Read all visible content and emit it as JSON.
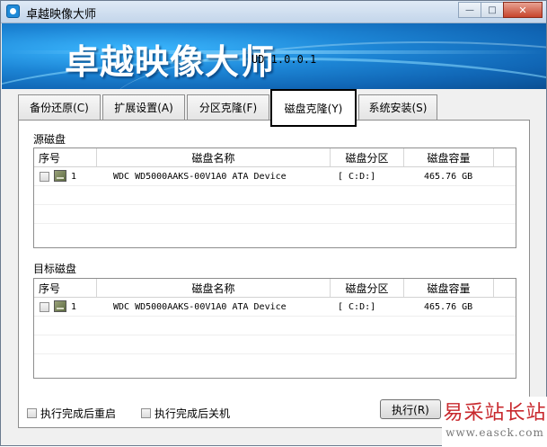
{
  "window": {
    "title": "卓越映像大师",
    "controls": {
      "minimize": "—",
      "maximize": "□",
      "close": "✕"
    }
  },
  "banner": {
    "title": "卓越映像大师",
    "version": "UD 1.0.0.1"
  },
  "tabs": [
    {
      "label": "备份还原(C)",
      "active": false
    },
    {
      "label": "扩展设置(A)",
      "active": false
    },
    {
      "label": "分区克隆(F)",
      "active": false
    },
    {
      "label": "磁盘克隆(Y)",
      "active": true
    },
    {
      "label": "系统安装(S)",
      "active": false
    }
  ],
  "source": {
    "label": "源磁盘",
    "columns": [
      "序号",
      "磁盘名称",
      "磁盘分区",
      "磁盘容量"
    ],
    "rows": [
      {
        "index": "1",
        "name": "WDC WD5000AAKS-00V1A0 ATA Device",
        "partition": "[ C:D:]",
        "capacity": "465.76 GB",
        "checked": false
      }
    ]
  },
  "target": {
    "label": "目标磁盘",
    "columns": [
      "序号",
      "磁盘名称",
      "磁盘分区",
      "磁盘容量"
    ],
    "rows": [
      {
        "index": "1",
        "name": "WDC WD5000AAKS-00V1A0 ATA Device",
        "partition": "[ C:D:]",
        "capacity": "465.76 GB",
        "checked": false
      }
    ]
  },
  "options": {
    "reboot_label": "执行完成后重启",
    "shutdown_label": "执行完成后关机"
  },
  "actions": {
    "execute_label": "执行(R)"
  },
  "watermark": {
    "title": "易采站长站",
    "url": "www.easck.com"
  },
  "colors": {
    "banner": "#1d86d6",
    "active_tab_border": "#000000",
    "watermark": "#c8282d"
  }
}
